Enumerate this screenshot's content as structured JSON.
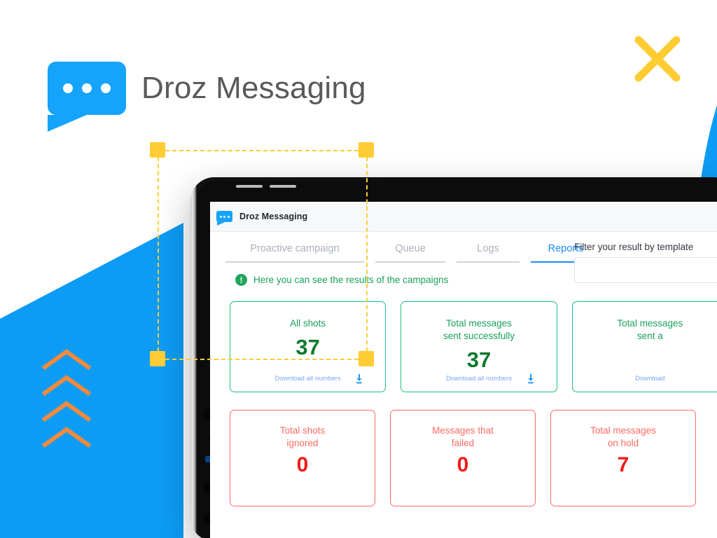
{
  "brand": {
    "title": "Droz Messaging",
    "logo_icon": "chat-bubble-icon",
    "accent_color": "#15a4fa"
  },
  "close_button": {
    "icon": "close-x-icon",
    "color": "#fc3"
  },
  "decor": {
    "chevron_icon": "chevron-up-icon",
    "chevron_count": 4,
    "chevron_color": "#f58a3c",
    "blue_color": "#0d9cf5",
    "selection_handle_color": "#fc3"
  },
  "app": {
    "titlebar": {
      "title": "Droz Messaging",
      "logo_icon": "chat-bubble-icon"
    },
    "tabs": [
      {
        "label": "Proactive campaign",
        "active": false
      },
      {
        "label": "Queue",
        "active": false
      },
      {
        "label": "Logs",
        "active": false
      },
      {
        "label": "Reports",
        "active": true
      }
    ],
    "filter": {
      "label": "Filter your result by template",
      "value": "",
      "placeholder": ""
    },
    "notice": {
      "icon": "info-exclamation-icon",
      "text": "Here you can see the results of the campaigns"
    },
    "cards_green": [
      {
        "title": "All shots",
        "value": "37",
        "download_label": "Download all numbers",
        "download_icon": "download-icon"
      },
      {
        "title": "Total messages\nsent successfully",
        "value": "37",
        "download_label": "Download all numbers",
        "download_icon": "download-icon"
      },
      {
        "title": "Total messages\nsent a",
        "value": "",
        "download_label": "Download",
        "download_icon": "download-icon"
      }
    ],
    "cards_red": [
      {
        "title": "Total shots\nignored",
        "value": "0"
      },
      {
        "title": "Messages that\nfailed",
        "value": "0"
      },
      {
        "title": "Total messages\non hold",
        "value": "7"
      }
    ]
  }
}
